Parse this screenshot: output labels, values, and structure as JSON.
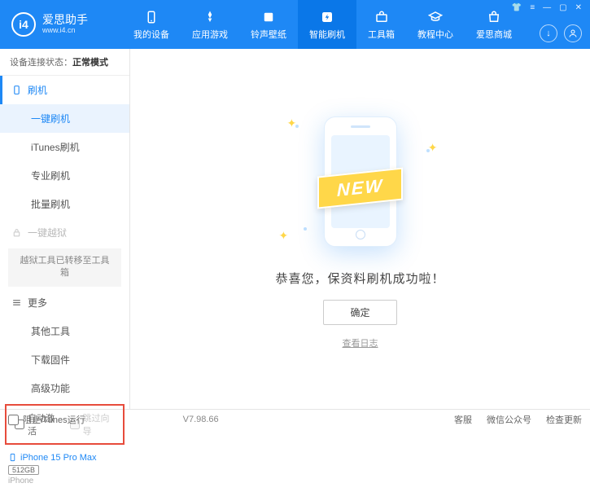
{
  "app": {
    "name": "爱思助手",
    "url": "www.i4.cn",
    "logo_letter": "i4"
  },
  "nav": [
    {
      "label": "我的设备",
      "icon": "device"
    },
    {
      "label": "应用游戏",
      "icon": "apps"
    },
    {
      "label": "铃声壁纸",
      "icon": "ringtone"
    },
    {
      "label": "智能刷机",
      "icon": "flash",
      "active": true
    },
    {
      "label": "工具箱",
      "icon": "toolbox"
    },
    {
      "label": "教程中心",
      "icon": "tutorial"
    },
    {
      "label": "爱思商城",
      "icon": "store"
    }
  ],
  "status": {
    "prefix": "设备连接状态：",
    "value": "正常模式"
  },
  "sidebar": {
    "category_flash": "刷机",
    "items_flash": [
      "一键刷机",
      "iTunes刷机",
      "专业刷机",
      "批量刷机"
    ],
    "category_jailbreak": "一键越狱",
    "jailbreak_box": "越狱工具已转移至工具箱",
    "category_more": "更多",
    "items_more": [
      "其他工具",
      "下载固件",
      "高级功能"
    ],
    "checkboxes": {
      "auto_activate": "自动激活",
      "skip_guide": "跳过向导"
    },
    "device": {
      "name": "iPhone 15 Pro Max",
      "storage": "512GB",
      "type": "iPhone"
    }
  },
  "main": {
    "banner": "NEW",
    "success_text": "恭喜您，保资料刷机成功啦！",
    "ok_button": "确定",
    "log_link": "查看日志"
  },
  "footer": {
    "block_itunes": "阻止iTunes运行",
    "version": "V7.98.66",
    "links": [
      "客服",
      "微信公众号",
      "检查更新"
    ]
  }
}
